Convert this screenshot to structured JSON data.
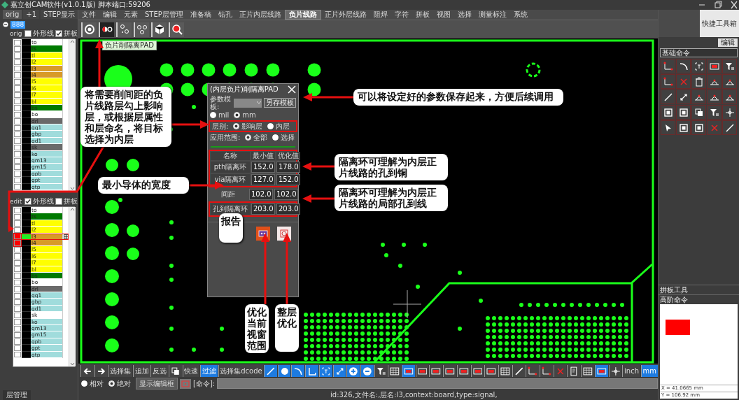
{
  "window": {
    "title": "嘉立创CAM软件(v1.0.1版) 脚本端口:59206"
  },
  "layer_panel": {
    "tabs": [
      {
        "label": "orig",
        "selected": true
      },
      {
        "label": "+1",
        "selected": false
      },
      {
        "label": "STEP显示",
        "selected": false
      }
    ],
    "job": "888",
    "steps": [
      {
        "name": "orig",
        "options": [
          {
            "label": "外形线",
            "checked": false
          },
          {
            "label": "拼板",
            "checked": true
          }
        ],
        "layers": [
          {
            "name": "to",
            "color": "#ffffff",
            "checked": false,
            "selected": false
          },
          {
            "name": "ts",
            "color": "#007a00",
            "checked": false,
            "selected": false
          },
          {
            "name": "tl",
            "color": "#ffff00",
            "checked": false,
            "selected": false
          },
          {
            "name": "l2",
            "color": "#ffff00",
            "checked": false,
            "selected": false
          },
          {
            "name": "l3",
            "color": "#d89a28",
            "checked": false,
            "selected": false
          },
          {
            "name": "l4",
            "color": "#d89a28",
            "checked": false,
            "selected": false
          },
          {
            "name": "l5",
            "color": "#ffff00",
            "checked": false,
            "selected": false
          },
          {
            "name": "l6",
            "color": "#ffff00",
            "checked": false,
            "selected": false
          },
          {
            "name": "l7",
            "color": "#ffff00",
            "checked": false,
            "selected": false
          },
          {
            "name": "bl",
            "color": "#ffff00",
            "checked": false,
            "selected": false
          },
          {
            "name": "bs",
            "color": "#007a00",
            "checked": false,
            "selected": false
          },
          {
            "name": "bo",
            "color": "#ffffff",
            "checked": false,
            "selected": false
          },
          {
            "name": "drl",
            "color": "#6a6a6a",
            "checked": false,
            "selected": false
          },
          {
            "name": "gg1",
            "color": "#a0dcdc",
            "checked": false,
            "selected": false
          },
          {
            "name": "gbp",
            "color": "#a0dcdc",
            "checked": false,
            "selected": false
          },
          {
            "name": "gd1",
            "color": "#a0dcdc",
            "checked": false,
            "selected": false
          },
          {
            "name": "sk",
            "color": "#6a6a6a",
            "checked": false,
            "selected": false
          },
          {
            "name": "ko",
            "color": "#a0dcdc",
            "checked": false,
            "selected": false
          },
          {
            "name": "gm13",
            "color": "#a0dcdc",
            "checked": false,
            "selected": false
          },
          {
            "name": "gm15",
            "color": "#a0dcdc",
            "checked": false,
            "selected": false
          },
          {
            "name": "gpb",
            "color": "#a0dcdc",
            "checked": false,
            "selected": false
          },
          {
            "name": "gpt",
            "color": "#a0dcdc",
            "checked": false,
            "selected": false
          },
          {
            "name": "gtp",
            "color": "#a0dcdc",
            "checked": false,
            "selected": false
          }
        ]
      },
      {
        "name": "edit",
        "options": [
          {
            "label": "外形线",
            "checked": true
          },
          {
            "label": "拼板",
            "checked": false
          }
        ],
        "layers": [
          {
            "name": "to",
            "color": "#ffffff",
            "checked": false,
            "selected": false
          },
          {
            "name": "ts",
            "color": "#007a00",
            "checked": false,
            "selected": false
          },
          {
            "name": "tl",
            "color": "#ffff00",
            "checked": false,
            "selected": false
          },
          {
            "name": "l2",
            "color": "#ffff00",
            "checked": false,
            "selected": false
          },
          {
            "name": "l3",
            "color": "#d89a28",
            "checked": true,
            "selected": true
          },
          {
            "name": "l4",
            "color": "#d89a28",
            "checked": true,
            "selected": false
          },
          {
            "name": "l5",
            "color": "#ffff00",
            "checked": false,
            "selected": false
          },
          {
            "name": "l6",
            "color": "#ffff00",
            "checked": false,
            "selected": false
          },
          {
            "name": "l7",
            "color": "#ffff00",
            "checked": false,
            "selected": false
          },
          {
            "name": "bl",
            "color": "#ffff00",
            "checked": false,
            "selected": false
          },
          {
            "name": "bs",
            "color": "#007a00",
            "checked": false,
            "selected": false
          },
          {
            "name": "bo",
            "color": "#ffffff",
            "checked": false,
            "selected": false
          },
          {
            "name": "drl",
            "color": "#6a6a6a",
            "checked": false,
            "selected": false
          },
          {
            "name": "gg1",
            "color": "#a0dcdc",
            "checked": false,
            "selected": false
          },
          {
            "name": "gbp",
            "color": "#a0dcdc",
            "checked": false,
            "selected": false
          },
          {
            "name": "gd1",
            "color": "#a0dcdc",
            "checked": false,
            "selected": false
          },
          {
            "name": "sk",
            "color": "#ffffff",
            "checked": false,
            "selected": false
          },
          {
            "name": "ko",
            "color": "#a0dcdc",
            "checked": false,
            "selected": false
          },
          {
            "name": "gm13",
            "color": "#a0dcdc",
            "checked": false,
            "selected": false
          },
          {
            "name": "gm15",
            "color": "#a0dcdc",
            "checked": false,
            "selected": false
          },
          {
            "name": "gpb",
            "color": "#a0dcdc",
            "checked": false,
            "selected": false
          },
          {
            "name": "gpt",
            "color": "#a0dcdc",
            "checked": false,
            "selected": false
          },
          {
            "name": "gtp",
            "color": "#a0dcdc",
            "checked": false,
            "selected": false
          }
        ]
      }
    ],
    "bottom_tab": "层管理"
  },
  "menu": [
    {
      "label": "文件",
      "selected": false
    },
    {
      "label": "编辑",
      "selected": false
    },
    {
      "label": "元素",
      "selected": false
    },
    {
      "label": "STEP层管理",
      "selected": false
    },
    {
      "label": "准备稿",
      "selected": false
    },
    {
      "label": "钻孔",
      "selected": false
    },
    {
      "label": "正片内层线路",
      "selected": false
    },
    {
      "label": "负片线路",
      "selected": true
    },
    {
      "label": "正片外层线路",
      "selected": false
    },
    {
      "label": "阻焊",
      "selected": false
    },
    {
      "label": "字符",
      "selected": false
    },
    {
      "label": "拼板",
      "selected": false
    },
    {
      "label": "视图",
      "selected": false
    },
    {
      "label": "选择",
      "selected": false
    },
    {
      "label": "测量标注",
      "selected": false
    },
    {
      "label": "系统",
      "selected": false
    }
  ],
  "toolbar": [
    {
      "selected": false
    },
    {
      "selected": true
    },
    {
      "selected": false
    },
    {
      "selected": false
    },
    {
      "selected": false
    },
    {
      "selected": false
    }
  ],
  "tooltip": "负片削隔离PAD",
  "dialog": {
    "title": "(内层负片)削隔离PAD",
    "template_label": "参数模板:",
    "save_button": "另存模板",
    "units": [
      {
        "label": "mil",
        "selected": false
      },
      {
        "label": "mm",
        "selected": true
      }
    ],
    "layer_type": {
      "label": "层别:",
      "options": [
        {
          "label": "影响层",
          "selected": true
        },
        {
          "label": "内层",
          "selected": false
        }
      ]
    },
    "scope": {
      "label": "应用范围:",
      "options": [
        {
          "label": "全部",
          "selected": true
        },
        {
          "label": "选择",
          "selected": false
        }
      ]
    },
    "table": {
      "columns": [
        "名称",
        "最小值",
        "优化值"
      ],
      "rows": [
        {
          "name": "pth隔离环",
          "min": "152.0",
          "opt": "178.0"
        },
        {
          "name": "via隔离环",
          "min": "127.0",
          "opt": "152.0"
        },
        {
          "name": "间距",
          "min": "102.0",
          "opt": "102.0"
        },
        {
          "name": "孔到隔离环",
          "min": "203.0",
          "opt": "203.0"
        }
      ]
    }
  },
  "callouts": [
    {
      "text": "将需要削间距的负片线路层勾上影响层，或根据层属性和层命名，将目标选择为内层"
    },
    {
      "text": "可以将设定好的参数保存起来，方便后续调用"
    },
    {
      "text": "隔离环可理解为内层正片线路的孔到铜"
    },
    {
      "text": "最小导体的宽度"
    },
    {
      "text": "隔离环可理解为内层正片线路的局部孔到线"
    },
    {
      "text": "报告"
    },
    {
      "text": "优化当前视窗范围"
    },
    {
      "text": "整层优化"
    }
  ],
  "bottom_toolbar": [
    {
      "kind": "tool",
      "selected": false
    },
    {
      "kind": "tool",
      "selected": false
    },
    {
      "kind": "text",
      "label": "选择集",
      "selected": false
    },
    {
      "kind": "text",
      "label": "追加",
      "selected": false
    },
    {
      "kind": "text",
      "label": "反选",
      "selected": false
    },
    {
      "kind": "tool",
      "selected": false
    },
    {
      "kind": "text",
      "label": "快速",
      "selected": false
    },
    {
      "kind": "text",
      "label": "过滤",
      "selected": true
    },
    {
      "kind": "text",
      "label": "选择集dcode",
      "selected": false
    },
    {
      "kind": "tool",
      "selected": true
    },
    {
      "kind": "tool",
      "selected": true
    },
    {
      "kind": "tool",
      "selected": true
    },
    {
      "kind": "tool",
      "selected": true
    },
    {
      "kind": "tool",
      "selected": true
    },
    {
      "kind": "tool",
      "selected": true
    },
    {
      "kind": "tool",
      "selected": true
    },
    {
      "kind": "tool",
      "selected": true
    },
    {
      "kind": "tool",
      "selected": false
    },
    {
      "kind": "tool",
      "selected": false
    },
    {
      "kind": "tool",
      "selected": true
    },
    {
      "kind": "tool",
      "selected": false
    },
    {
      "kind": "tool",
      "selected": false
    },
    {
      "kind": "tool",
      "selected": false
    },
    {
      "kind": "tool",
      "selected": false
    },
    {
      "kind": "tool",
      "selected": false
    },
    {
      "kind": "tool",
      "selected": false
    },
    {
      "kind": "tool",
      "selected": false
    },
    {
      "kind": "tool",
      "selected": false
    },
    {
      "kind": "tool",
      "selected": false
    },
    {
      "kind": "tool",
      "selected": false
    },
    {
      "kind": "tool",
      "selected": false
    },
    {
      "kind": "tool",
      "selected": false
    },
    {
      "kind": "tool",
      "selected": false
    },
    {
      "kind": "tool",
      "selected": true
    },
    {
      "kind": "tool",
      "selected": false
    },
    {
      "kind": "text",
      "label": "inch",
      "selected": false
    },
    {
      "kind": "text",
      "label": "mm",
      "selected": true
    }
  ],
  "coord_modes": [
    {
      "label": "相对",
      "selected": false
    },
    {
      "label": "绝对",
      "selected": true
    }
  ],
  "edit_box_button": "显示编辑框",
  "command_label": "[命令]:",
  "status": "id:326,文件名:,层名:l3,context:board,type:signal,",
  "right_panel": {
    "quick_toolbox": "快捷工具箱",
    "edit_button": "编辑",
    "basic_header": "基础命令",
    "sections": [
      "拼板工具",
      "高阶命令"
    ],
    "coords": [
      "X = 41.0665 mm",
      "Y = 106.92 mm"
    ]
  }
}
